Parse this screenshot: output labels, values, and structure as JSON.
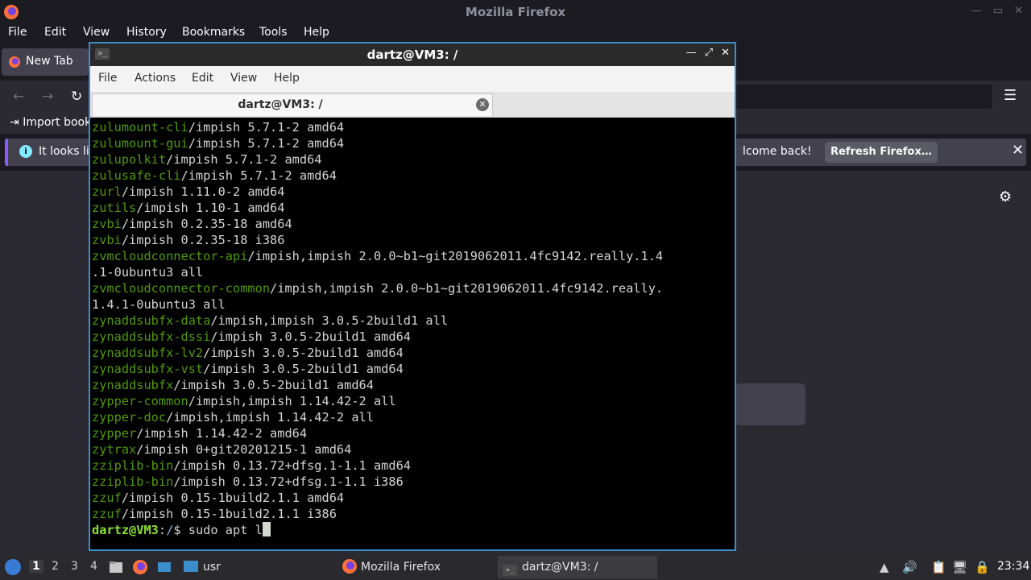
{
  "firefox": {
    "window_title": "Mozilla Firefox",
    "menu": [
      "File",
      "Edit",
      "View",
      "History",
      "Bookmarks",
      "Tools",
      "Help"
    ],
    "tab_label": "New Tab",
    "bookmark_import": "Import book",
    "notice_left": "It looks lik",
    "notice_right": "lcome back!",
    "refresh_button": "Refresh Firefox…"
  },
  "terminal": {
    "window_title": "dartz@VM3: /",
    "menu": [
      "File",
      "Actions",
      "Edit",
      "View",
      "Help"
    ],
    "tab_label": "dartz@VM3: /",
    "lines": [
      {
        "pkg": "zulumount-cli",
        "rest": "/impish 5.7.1-2 amd64"
      },
      {
        "pkg": "zulumount-gui",
        "rest": "/impish 5.7.1-2 amd64"
      },
      {
        "pkg": "zulupolkit",
        "rest": "/impish 5.7.1-2 amd64"
      },
      {
        "pkg": "zulusafe-cli",
        "rest": "/impish 5.7.1-2 amd64"
      },
      {
        "pkg": "zurl",
        "rest": "/impish 1.11.0-2 amd64"
      },
      {
        "pkg": "zutils",
        "rest": "/impish 1.10-1 amd64"
      },
      {
        "pkg": "zvbi",
        "rest": "/impish 0.2.35-18 amd64"
      },
      {
        "pkg": "zvbi",
        "rest": "/impish 0.2.35-18 i386"
      },
      {
        "pkg": "zvmcloudconnector-api",
        "rest": "/impish,impish 2.0.0~b1~git2019062011.4fc9142.really.1.4"
      },
      {
        "pkg": "",
        "rest": ".1-0ubuntu3 all"
      },
      {
        "pkg": "zvmcloudconnector-common",
        "rest": "/impish,impish 2.0.0~b1~git2019062011.4fc9142.really."
      },
      {
        "pkg": "",
        "rest": "1.4.1-0ubuntu3 all"
      },
      {
        "pkg": "zynaddsubfx-data",
        "rest": "/impish,impish 3.0.5-2build1 all"
      },
      {
        "pkg": "zynaddsubfx-dssi",
        "rest": "/impish 3.0.5-2build1 amd64"
      },
      {
        "pkg": "zynaddsubfx-lv2",
        "rest": "/impish 3.0.5-2build1 amd64"
      },
      {
        "pkg": "zynaddsubfx-vst",
        "rest": "/impish 3.0.5-2build1 amd64"
      },
      {
        "pkg": "zynaddsubfx",
        "rest": "/impish 3.0.5-2build1 amd64"
      },
      {
        "pkg": "zypper-common",
        "rest": "/impish,impish 1.14.42-2 all"
      },
      {
        "pkg": "zypper-doc",
        "rest": "/impish,impish 1.14.42-2 all"
      },
      {
        "pkg": "zypper",
        "rest": "/impish 1.14.42-2 amd64"
      },
      {
        "pkg": "zytrax",
        "rest": "/impish 0+git20201215-1 amd64"
      },
      {
        "pkg": "zziplib-bin",
        "rest": "/impish 0.13.72+dfsg.1-1.1 amd64"
      },
      {
        "pkg": "zziplib-bin",
        "rest": "/impish 0.13.72+dfsg.1-1.1 i386"
      },
      {
        "pkg": "zzuf",
        "rest": "/impish 0.15-1build2.1.1 amd64"
      },
      {
        "pkg": "zzuf",
        "rest": "/impish 0.15-1build2.1.1 i386"
      }
    ],
    "prompt_user": "dartz@VM3",
    "prompt_sep": ":",
    "prompt_path": "/",
    "prompt_symbol": "$ ",
    "command": "sudo apt l"
  },
  "taskbar": {
    "workspaces": [
      "1",
      "2",
      "3",
      "4"
    ],
    "folder_task": "usr",
    "firefox_task": "Mozilla Firefox",
    "terminal_task": "dartz@VM3: /",
    "clock": "23:34"
  }
}
